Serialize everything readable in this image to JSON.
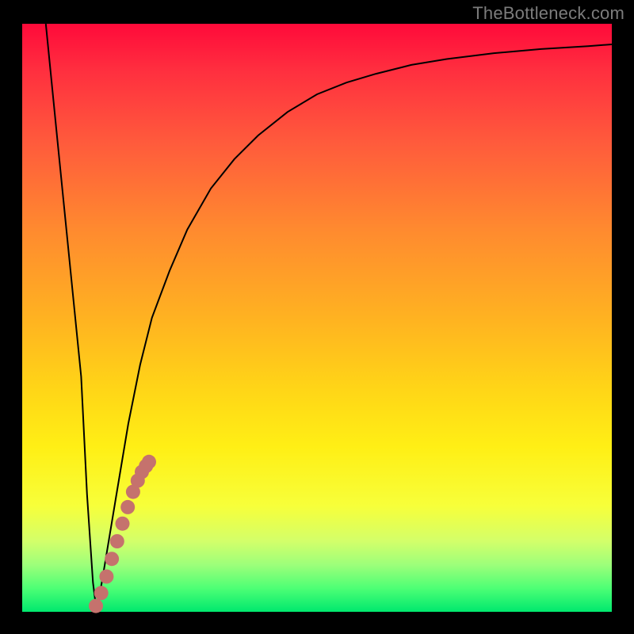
{
  "watermark": "TheBottleneck.com",
  "colors": {
    "frame": "#000000",
    "curve_stroke": "#000000",
    "marker_fill": "#c5726d",
    "marker_stroke": "#a85a55"
  },
  "chart_data": {
    "type": "line",
    "title": "",
    "xlabel": "",
    "ylabel": "",
    "xlim": [
      0,
      100
    ],
    "ylim": [
      0,
      100
    ],
    "grid": false,
    "legend": false,
    "series": [
      {
        "name": "bottleneck-curve",
        "x": [
          4,
          6,
          8,
          10,
          11,
          12,
          12.5,
          13,
          14,
          16,
          18,
          20,
          22,
          25,
          28,
          32,
          36,
          40,
          45,
          50,
          55,
          60,
          66,
          72,
          80,
          88,
          96,
          100
        ],
        "y": [
          100,
          80,
          60,
          40,
          20,
          5,
          1,
          2,
          8,
          20,
          32,
          42,
          50,
          58,
          65,
          72,
          77,
          81,
          85,
          88,
          90,
          91.5,
          93,
          94,
          95,
          95.7,
          96.2,
          96.5
        ]
      }
    ],
    "markers": {
      "name": "highlighted-segment",
      "x": [
        12.5,
        13.4,
        14.3,
        15.2,
        16.1,
        17.0,
        17.9,
        18.8,
        19.6,
        20.3,
        21.0,
        21.5
      ],
      "y": [
        1.0,
        3.2,
        6.0,
        9.0,
        12.0,
        15.0,
        17.8,
        20.4,
        22.3,
        23.8,
        24.8,
        25.5
      ]
    }
  }
}
